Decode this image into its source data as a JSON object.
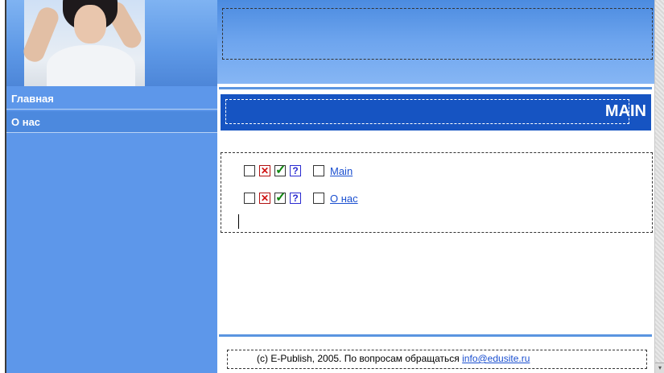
{
  "nav": {
    "items": [
      {
        "label": "Главная"
      },
      {
        "label": "О нас"
      }
    ]
  },
  "main": {
    "title": "MAIN",
    "rows": [
      {
        "link": "Main"
      },
      {
        "link": "О нас"
      }
    ],
    "icons": [
      "blank-box-icon",
      "delete-x-icon",
      "approve-check-icon",
      "help-question-icon",
      "blank-box-icon"
    ]
  },
  "footer": {
    "text": "(c) E-Publish, 2005. По вопросам обращаться",
    "email": "info@edusite.ru"
  },
  "colors": {
    "title_bar": "#1654c2",
    "nav_bg": "#5d97ea",
    "link": "#1a4fd0"
  }
}
